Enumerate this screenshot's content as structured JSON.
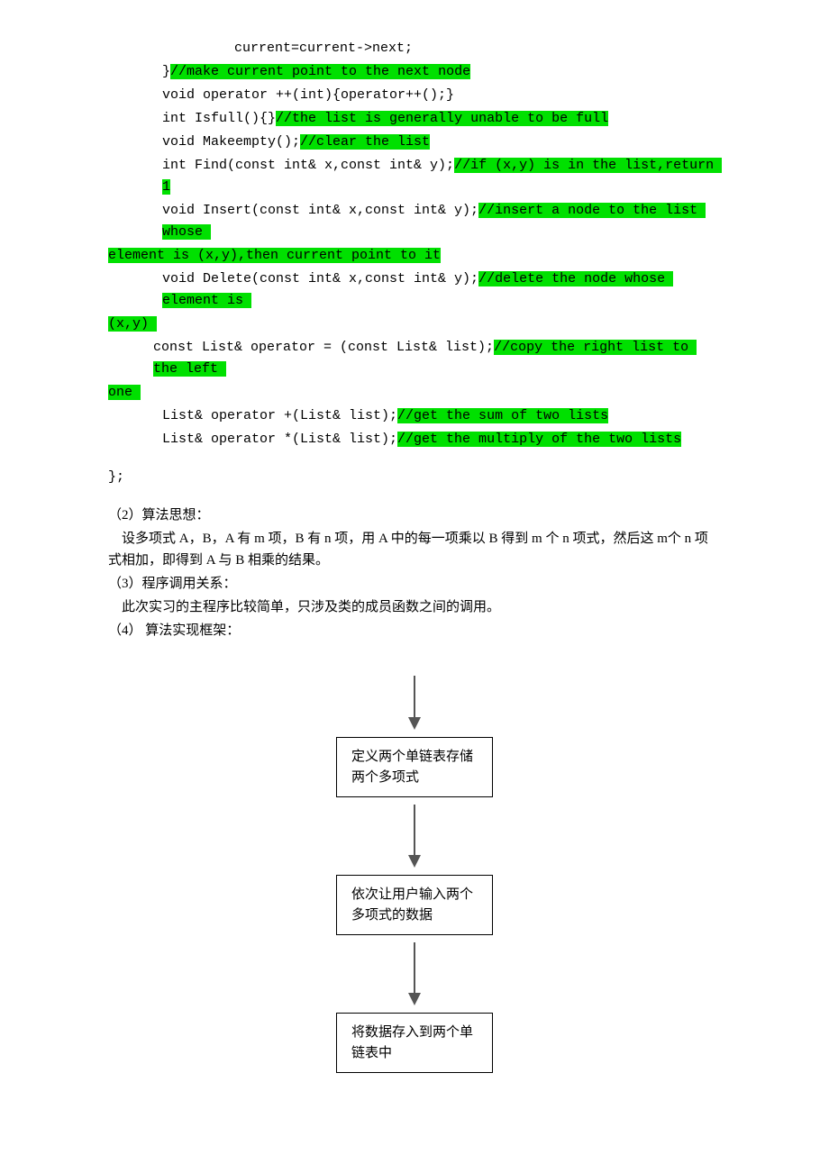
{
  "code": {
    "l1": "current=current->next;",
    "l2_pre": "}",
    "l2_hl": "//make current point to the next node",
    "l3": "void operator ++(int){operator++();}",
    "l4_pre": "int Isfull(){}",
    "l4_hl": "//the list is generally unable to be full",
    "l5_pre": "void Makeempty();",
    "l5_hl": "//clear the list",
    "l6_pre": "int Find(const int& x,const int& y);",
    "l6_hl": "//if (x,y) is in the list,return 1",
    "l7_pre": "void Insert(const int& x,const int& y);",
    "l7_hl": "//insert a node to the list whose ",
    "l7b_hl": "element is (x,y),then current point to it",
    "l8_pre": "void Delete(const int& x,const int& y);",
    "l8_hl": "//delete the node whose element is ",
    "l8b_hl": "(x,y) ",
    "l9_pre": "const List& operator = (const List& list);",
    "l9_hl": "//copy the right list to the left ",
    "l9b_hl": "one ",
    "l10_pre": "List& operator +(List& list);",
    "l10_hl": "//get the sum of two lists",
    "l11_pre": "List& operator *(List& list);",
    "l11_hl": "//get the multiply of the two lists",
    "l12": "};"
  },
  "text": {
    "s2_title": "（2）算法思想：",
    "s2_p1": "设多项式 A，B，A 有 m 项，B 有 n 项，用 A 中的每一项乘以 B 得到 m 个 n 项式，然后这 m个 n 项式相加，即得到 A 与 B 相乘的结果。",
    "s3_title": "（3）程序调用关系：",
    "s3_p1": "此次实习的主程序比较简单，只涉及类的成员函数之间的调用。",
    "s4_title": "（4） 算法实现框架："
  },
  "flow": {
    "b1": "定义两个单链表存储两个多项式",
    "b2": "依次让用户输入两个多项式的数据",
    "b3": "将数据存入到两个单链表中"
  }
}
